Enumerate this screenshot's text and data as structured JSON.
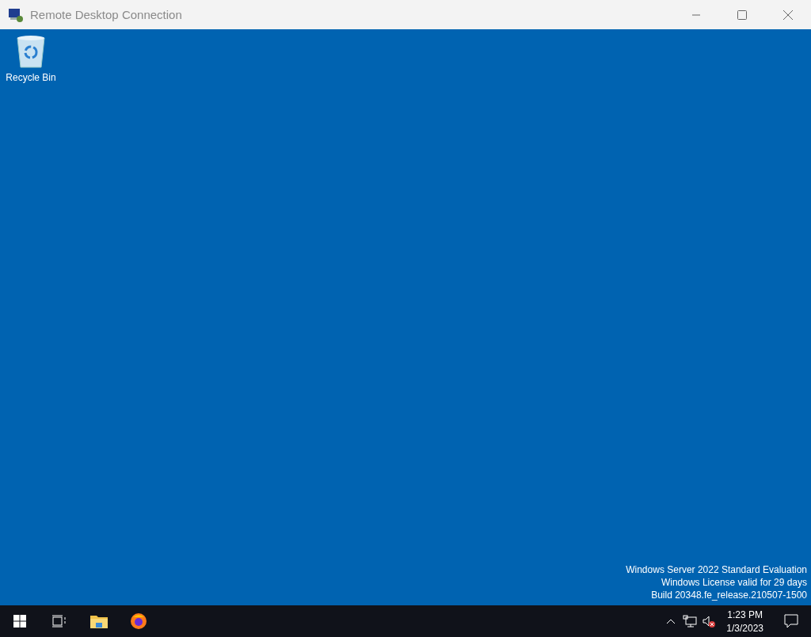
{
  "window": {
    "title": "Remote Desktop Connection"
  },
  "desktop": {
    "icons": [
      {
        "label": "Recycle Bin"
      }
    ],
    "evaluation_notice": [
      "Windows Server 2022 Standard Evaluation",
      "Windows License valid for 29 days",
      "Build 20348.fe_release.210507-1500"
    ]
  },
  "taskbar": {
    "clock": {
      "time": "1:23 PM",
      "date": "1/3/2023"
    }
  }
}
